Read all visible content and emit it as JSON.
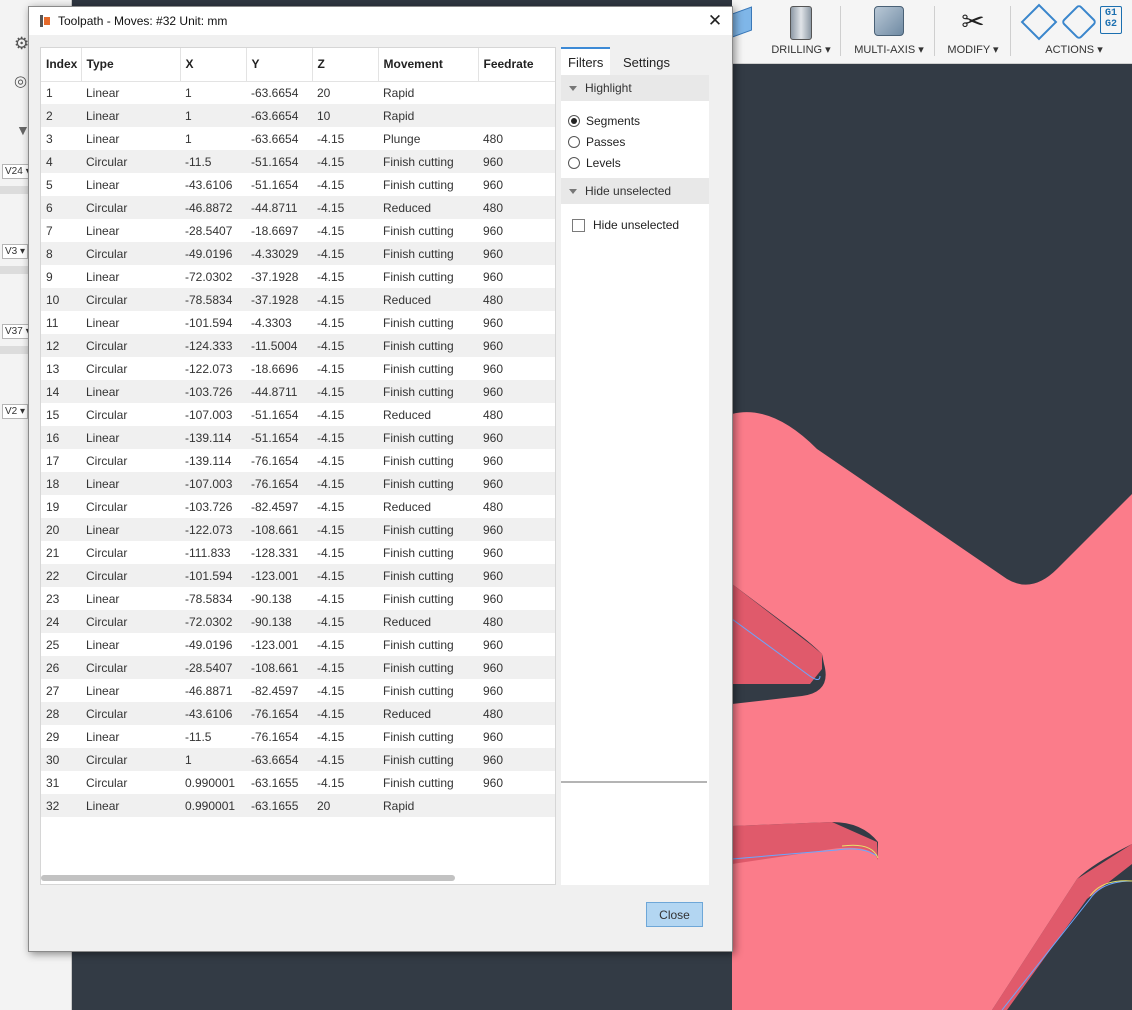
{
  "window": {
    "title": "Toolpath - Moves: #32 Unit: mm",
    "close_glyph": "✕",
    "close_button": "Close"
  },
  "table": {
    "columns": [
      "Index",
      "Type",
      "X",
      "Y",
      "Z",
      "Movement",
      "Feedrate"
    ],
    "rows": [
      [
        "1",
        "Linear",
        "1",
        "-63.6654",
        "20",
        "Rapid",
        ""
      ],
      [
        "2",
        "Linear",
        "1",
        "-63.6654",
        "10",
        "Rapid",
        ""
      ],
      [
        "3",
        "Linear",
        "1",
        "-63.6654",
        "-4.15",
        "Plunge",
        "480"
      ],
      [
        "4",
        "Circular",
        "-11.5",
        "-51.1654",
        "-4.15",
        "Finish cutting",
        "960"
      ],
      [
        "5",
        "Linear",
        "-43.6106",
        "-51.1654",
        "-4.15",
        "Finish cutting",
        "960"
      ],
      [
        "6",
        "Circular",
        "-46.8872",
        "-44.8711",
        "-4.15",
        "Reduced",
        "480"
      ],
      [
        "7",
        "Linear",
        "-28.5407",
        "-18.6697",
        "-4.15",
        "Finish cutting",
        "960"
      ],
      [
        "8",
        "Circular",
        "-49.0196",
        "-4.33029",
        "-4.15",
        "Finish cutting",
        "960"
      ],
      [
        "9",
        "Linear",
        "-72.0302",
        "-37.1928",
        "-4.15",
        "Finish cutting",
        "960"
      ],
      [
        "10",
        "Circular",
        "-78.5834",
        "-37.1928",
        "-4.15",
        "Reduced",
        "480"
      ],
      [
        "11",
        "Linear",
        "-101.594",
        "-4.3303",
        "-4.15",
        "Finish cutting",
        "960"
      ],
      [
        "12",
        "Circular",
        "-124.333",
        "-11.5004",
        "-4.15",
        "Finish cutting",
        "960"
      ],
      [
        "13",
        "Circular",
        "-122.073",
        "-18.6696",
        "-4.15",
        "Finish cutting",
        "960"
      ],
      [
        "14",
        "Linear",
        "-103.726",
        "-44.8711",
        "-4.15",
        "Finish cutting",
        "960"
      ],
      [
        "15",
        "Circular",
        "-107.003",
        "-51.1654",
        "-4.15",
        "Reduced",
        "480"
      ],
      [
        "16",
        "Linear",
        "-139.114",
        "-51.1654",
        "-4.15",
        "Finish cutting",
        "960"
      ],
      [
        "17",
        "Circular",
        "-139.114",
        "-76.1654",
        "-4.15",
        "Finish cutting",
        "960"
      ],
      [
        "18",
        "Linear",
        "-107.003",
        "-76.1654",
        "-4.15",
        "Finish cutting",
        "960"
      ],
      [
        "19",
        "Circular",
        "-103.726",
        "-82.4597",
        "-4.15",
        "Reduced",
        "480"
      ],
      [
        "20",
        "Linear",
        "-122.073",
        "-108.661",
        "-4.15",
        "Finish cutting",
        "960"
      ],
      [
        "21",
        "Circular",
        "-111.833",
        "-128.331",
        "-4.15",
        "Finish cutting",
        "960"
      ],
      [
        "22",
        "Circular",
        "-101.594",
        "-123.001",
        "-4.15",
        "Finish cutting",
        "960"
      ],
      [
        "23",
        "Linear",
        "-78.5834",
        "-90.138",
        "-4.15",
        "Finish cutting",
        "960"
      ],
      [
        "24",
        "Circular",
        "-72.0302",
        "-90.138",
        "-4.15",
        "Reduced",
        "480"
      ],
      [
        "25",
        "Linear",
        "-49.0196",
        "-123.001",
        "-4.15",
        "Finish cutting",
        "960"
      ],
      [
        "26",
        "Circular",
        "-28.5407",
        "-108.661",
        "-4.15",
        "Finish cutting",
        "960"
      ],
      [
        "27",
        "Linear",
        "-46.8871",
        "-82.4597",
        "-4.15",
        "Finish cutting",
        "960"
      ],
      [
        "28",
        "Circular",
        "-43.6106",
        "-76.1654",
        "-4.15",
        "Reduced",
        "480"
      ],
      [
        "29",
        "Linear",
        "-11.5",
        "-76.1654",
        "-4.15",
        "Finish cutting",
        "960"
      ],
      [
        "30",
        "Circular",
        "1",
        "-63.6654",
        "-4.15",
        "Finish cutting",
        "960"
      ],
      [
        "31",
        "Circular",
        "0.990001",
        "-63.1655",
        "-4.15",
        "Finish cutting",
        "960"
      ],
      [
        "32",
        "Linear",
        "0.990001",
        "-63.1655",
        "20",
        "Rapid",
        ""
      ]
    ]
  },
  "side_panel": {
    "tabs": [
      "Filters",
      "Settings"
    ],
    "highlight": {
      "header": "Highlight",
      "options": [
        "Segments",
        "Passes",
        "Levels"
      ],
      "selected": "Segments"
    },
    "hide": {
      "header": "Hide unselected",
      "checkbox_label": "Hide unselected",
      "checked": false
    }
  },
  "toolbar": {
    "groups": [
      {
        "label": "DRILLING ▾",
        "icons": [
          "drill-icon"
        ]
      },
      {
        "label": "MULTI-AXIS ▾",
        "icons": [
          "multi-axis-icon"
        ]
      },
      {
        "label": "MODIFY ▾",
        "icons": [
          "scissors-icon"
        ]
      },
      {
        "label": "ACTIONS ▾",
        "icons": [
          "simulate-icon",
          "post-process-icon",
          "gcode-icon"
        ]
      }
    ],
    "gcode_icon_text": "G1\nG2"
  },
  "left_browser": {
    "chips": [
      "V24 ▾",
      "V3 ▾",
      "V37 ▾",
      "V2 ▾"
    ],
    "icons": [
      "gear-icon",
      "globe-icon",
      "funnel-icon"
    ]
  },
  "colors": {
    "rapid": "#c7c231",
    "plunge": "#e23a3a",
    "finish": "#2424cc",
    "reduced": "#d62828",
    "part": "#fb7c8a",
    "part_side": "#e05a6b",
    "viewport": "#333b45",
    "accent": "#3d8ad6"
  }
}
